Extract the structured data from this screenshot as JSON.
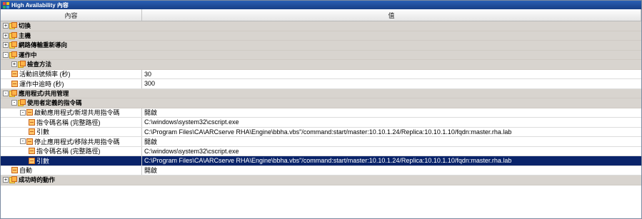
{
  "window": {
    "title": "High Availability 內容"
  },
  "columns": {
    "name": "內容",
    "value": "值"
  },
  "rows": [
    {
      "label": "切換",
      "value": "",
      "indent": 0,
      "expander": "+",
      "icon": "folder",
      "group": true
    },
    {
      "label": "主機",
      "value": "",
      "indent": 0,
      "expander": "+",
      "icon": "folder",
      "group": true
    },
    {
      "label": "網路傳輸重新導向",
      "value": "",
      "indent": 0,
      "expander": "+",
      "icon": "folder",
      "group": true
    },
    {
      "label": "運作中",
      "value": "",
      "indent": 0,
      "expander": "-",
      "icon": "folder",
      "group": true
    },
    {
      "label": "檢查方法",
      "value": "",
      "indent": 1,
      "expander": "+",
      "icon": "folder",
      "group": true
    },
    {
      "label": "活動訊號頻率 (秒)",
      "value": "30",
      "indent": 1,
      "expander": "",
      "icon": "property",
      "group": false
    },
    {
      "label": "運作中逾時 (秒)",
      "value": "300",
      "indent": 1,
      "expander": "",
      "icon": "property",
      "group": false
    },
    {
      "label": "應用程式/共用管理",
      "value": "",
      "indent": 0,
      "expander": "-",
      "icon": "folder",
      "group": true
    },
    {
      "label": "使用者定義的指令碼",
      "value": "",
      "indent": 1,
      "expander": "-",
      "icon": "folder",
      "group": true
    },
    {
      "label": "啟動應用程式/新增共用指令碼",
      "value": "開啟",
      "indent": 2,
      "expander": "-",
      "icon": "property",
      "group": false
    },
    {
      "label": "指令碼名稱 (完整路徑)",
      "value": "C:\\windows\\system32\\cscript.exe",
      "indent": 3,
      "expander": "",
      "icon": "property",
      "group": false
    },
    {
      "label": "引數",
      "value": "C:\\Program Files\\CA\\ARCserve RHA\\Engine\\bbha.vbs\"/command:start/master:10.10.1.24/Replica:10.10.1.10/fqdn:master.rha.lab",
      "indent": 3,
      "expander": "",
      "icon": "property",
      "group": false
    },
    {
      "label": "停止應用程式/移除共用指令碼",
      "value": "開啟",
      "indent": 2,
      "expander": "-",
      "icon": "property",
      "group": false
    },
    {
      "label": "指令碼名稱 (完整路徑)",
      "value": "C:\\windows\\system32\\cscript.exe",
      "indent": 3,
      "expander": "",
      "icon": "property",
      "group": false
    },
    {
      "label": "引數",
      "value": "C:\\Program Files\\CA\\ARCserve RHA\\Engine\\bbha.vbs\"/command:start/master:10.10.1.24/Replica:10.10.1.10/fqdn:master.rha.lab",
      "indent": 3,
      "expander": "",
      "icon": "property",
      "group": false,
      "selected": true
    },
    {
      "label": "自動",
      "value": "開啟",
      "indent": 1,
      "expander": "",
      "icon": "property",
      "group": false
    },
    {
      "label": "成功時的動作",
      "value": "",
      "indent": 0,
      "expander": "+",
      "icon": "folder",
      "group": true
    }
  ]
}
